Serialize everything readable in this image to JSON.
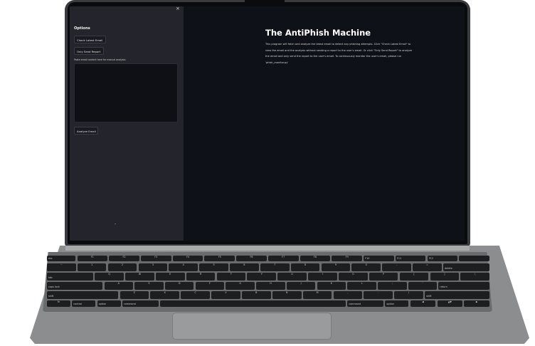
{
  "sidebar": {
    "close_label": "×",
    "title": "Options",
    "check_email_label": "Check Latest Email",
    "send_report_label": "Only Send Report",
    "textarea_label": "Paste email content here for manual analysis:",
    "analyze_label": "Analyze Email"
  },
  "main": {
    "title": "The AntiPhish Machine",
    "description": "This program will fetch and analyze the latest email to detect any phishing attempts. Click \"Check Latest Email\" to view the email and the analysis without sending a report to the user's email. Or click \"Only Send Report\" to analyze the email and only send the report to the user's email. To continuously monitor the user's email, please run 'phish_monitor.py'"
  },
  "keyboard": {
    "rows": [
      [
        {
          "l": "esc",
          "w": 18
        },
        {
          "l": "F1",
          "w": 19
        },
        {
          "l": "F2",
          "w": 19
        },
        {
          "l": "F3",
          "w": 19
        },
        {
          "l": "F4",
          "w": 19
        },
        {
          "l": "F5",
          "w": 19
        },
        {
          "l": "F6",
          "w": 19
        },
        {
          "l": "F7",
          "w": 19
        },
        {
          "l": "F8",
          "w": 19
        },
        {
          "l": "F9",
          "w": 19
        },
        {
          "l": "F10",
          "w": 19
        },
        {
          "l": "F11",
          "w": 19
        },
        {
          "l": "F12",
          "w": 19
        },
        {
          "l": "",
          "w": 19
        }
      ],
      [
        {
          "l": "~",
          "w": 30
        },
        {
          "l": "1",
          "w": 30
        },
        {
          "l": "2",
          "w": 30
        },
        {
          "l": "3",
          "w": 30
        },
        {
          "l": "4",
          "w": 30
        },
        {
          "l": "5",
          "w": 30
        },
        {
          "l": "6",
          "w": 30
        },
        {
          "l": "7",
          "w": 30
        },
        {
          "l": "8",
          "w": 30
        },
        {
          "l": "9",
          "w": 30
        },
        {
          "l": "0",
          "w": 30
        },
        {
          "l": "-",
          "w": 30
        },
        {
          "l": "=",
          "w": 30
        },
        {
          "l": "delete",
          "w": 48
        }
      ],
      [
        {
          "l": "tab",
          "w": 48
        },
        {
          "l": "Q",
          "w": 30
        },
        {
          "l": "W",
          "w": 30
        },
        {
          "l": "E",
          "w": 30
        },
        {
          "l": "R",
          "w": 30
        },
        {
          "l": "T",
          "w": 30
        },
        {
          "l": "Y",
          "w": 30
        },
        {
          "l": "U",
          "w": 30
        },
        {
          "l": "I",
          "w": 30
        },
        {
          "l": "O",
          "w": 30
        },
        {
          "l": "P",
          "w": 30
        },
        {
          "l": "[",
          "w": 30
        },
        {
          "l": "]",
          "w": 30
        },
        {
          "l": "\\",
          "w": 30
        }
      ],
      [
        {
          "l": "caps lock",
          "w": 58
        },
        {
          "l": "A",
          "w": 30
        },
        {
          "l": "S",
          "w": 30
        },
        {
          "l": "D",
          "w": 30
        },
        {
          "l": "F",
          "w": 30
        },
        {
          "l": "G",
          "w": 30
        },
        {
          "l": "H",
          "w": 30
        },
        {
          "l": "J",
          "w": 30
        },
        {
          "l": "K",
          "w": 30
        },
        {
          "l": "L",
          "w": 30
        },
        {
          "l": ";",
          "w": 30
        },
        {
          "l": "'",
          "w": 30
        },
        {
          "l": "return",
          "w": 53
        }
      ],
      [
        {
          "l": "shift",
          "w": 74
        },
        {
          "l": "Z",
          "w": 30
        },
        {
          "l": "X",
          "w": 30
        },
        {
          "l": "C",
          "w": 30
        },
        {
          "l": "V",
          "w": 30
        },
        {
          "l": "B",
          "w": 30
        },
        {
          "l": "N",
          "w": 30
        },
        {
          "l": "M",
          "w": 30
        },
        {
          "l": ",",
          "w": 30
        },
        {
          "l": ".",
          "w": 30
        },
        {
          "l": "/",
          "w": 30
        },
        {
          "l": "shift",
          "w": 67
        }
      ],
      [
        {
          "l": "fn",
          "w": 26
        },
        {
          "l": "control",
          "w": 26
        },
        {
          "l": "option",
          "w": 26
        },
        {
          "l": "command",
          "w": 40
        },
        {
          "l": "",
          "w": 205
        },
        {
          "l": "command",
          "w": 40
        },
        {
          "l": "option",
          "w": 26
        },
        {
          "l": "◀",
          "w": 28
        },
        {
          "l": "▲▼",
          "w": 28
        },
        {
          "l": "▶",
          "w": 28
        }
      ]
    ]
  }
}
